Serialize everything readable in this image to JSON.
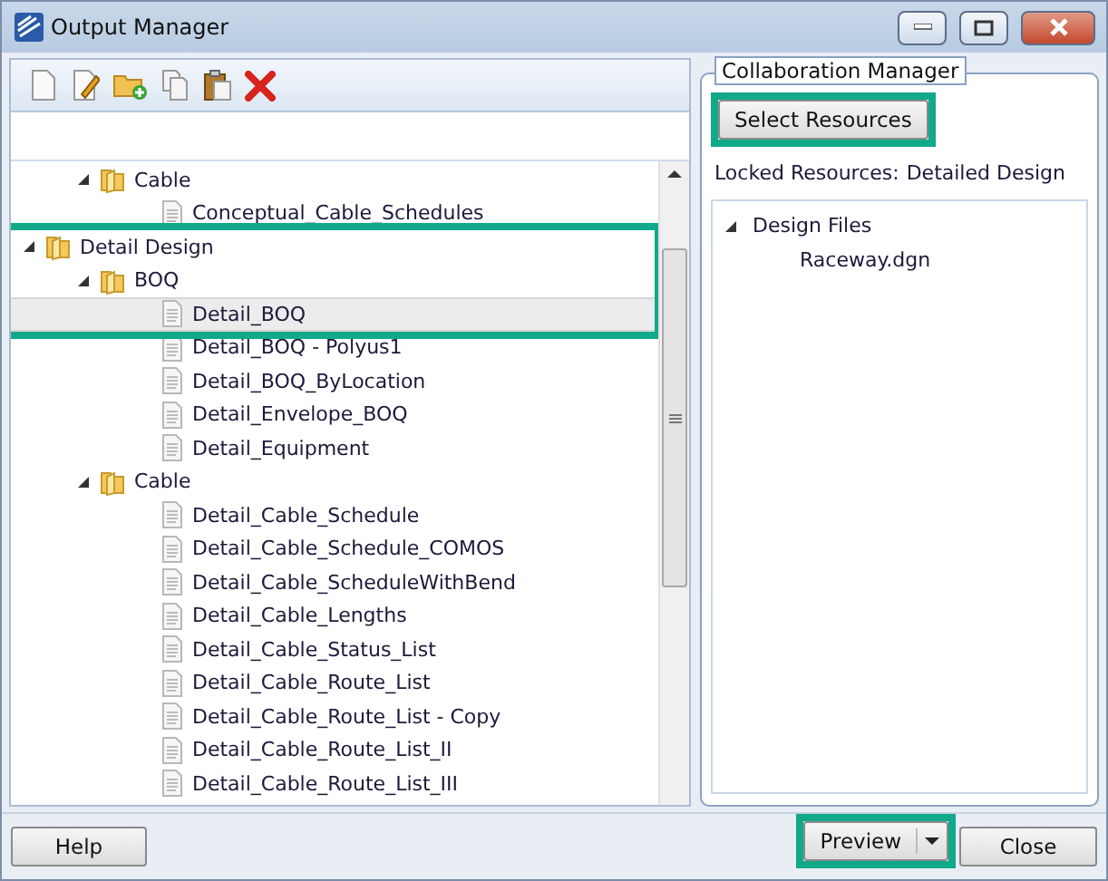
{
  "window": {
    "title": "Output Manager"
  },
  "toolbar": [
    {
      "kind": "new"
    },
    {
      "kind": "edit"
    },
    {
      "kind": "add-folder"
    },
    {
      "kind": "copy"
    },
    {
      "kind": "paste"
    },
    {
      "kind": "delete"
    }
  ],
  "tree": {
    "scrolled_branch": [
      {
        "label": "Cable",
        "kind": "folder",
        "expanded": true,
        "selected": false,
        "highlighted": false,
        "children": [
          {
            "label": "Conceptual_Cable_Schedules",
            "kind": "file",
            "selected": false,
            "highlighted": false
          }
        ]
      }
    ],
    "items": [
      {
        "label": "Detail Design",
        "kind": "folder",
        "expanded": true,
        "selected": false,
        "highlighted": true,
        "children": [
          {
            "label": "BOQ",
            "kind": "folder",
            "expanded": true,
            "selected": false,
            "highlighted": true,
            "children": [
              {
                "label": "Detail_BOQ",
                "kind": "file",
                "selected": true,
                "highlighted": true
              },
              {
                "label": "Detail_BOQ - Polyus1",
                "kind": "file",
                "selected": false,
                "highlighted": false
              },
              {
                "label": "Detail_BOQ_ByLocation",
                "kind": "file",
                "selected": false,
                "highlighted": false
              },
              {
                "label": "Detail_Envelope_BOQ",
                "kind": "file",
                "selected": false,
                "highlighted": false
              },
              {
                "label": "Detail_Equipment",
                "kind": "file",
                "selected": false,
                "highlighted": false
              }
            ]
          },
          {
            "label": "Cable",
            "kind": "folder",
            "expanded": true,
            "selected": false,
            "highlighted": false,
            "children": [
              {
                "label": "Detail_Cable_Schedule",
                "kind": "file",
                "selected": false,
                "highlighted": false
              },
              {
                "label": "Detail_Cable_Schedule_COMOS",
                "kind": "file",
                "selected": false,
                "highlighted": false
              },
              {
                "label": "Detail_Cable_ScheduleWithBend",
                "kind": "file",
                "selected": false,
                "highlighted": false
              },
              {
                "label": "Detail_Cable_Lengths",
                "kind": "file",
                "selected": false,
                "highlighted": false
              },
              {
                "label": "Detail_Cable_Status_List",
                "kind": "file",
                "selected": false,
                "highlighted": false
              },
              {
                "label": "Detail_Cable_Route_List",
                "kind": "file",
                "selected": false,
                "highlighted": false
              },
              {
                "label": "Detail_Cable_Route_List - Copy",
                "kind": "file",
                "selected": false,
                "highlighted": false
              },
              {
                "label": "Detail_Cable_Route_List_II",
                "kind": "file",
                "selected": false,
                "highlighted": false
              },
              {
                "label": "Detail_Cable_Route_List_III",
                "kind": "file",
                "selected": false,
                "highlighted": false
              }
            ]
          }
        ]
      }
    ]
  },
  "collaboration": {
    "title": "Collaboration Manager",
    "select_button": {
      "label": "Select Resources",
      "highlighted": true
    },
    "locked_label": "Locked Resources:",
    "locked_value": "Detailed Design",
    "files": [
      {
        "label": "Design Files",
        "expanded": true,
        "children": [
          {
            "label": "Raceway.dgn"
          }
        ]
      }
    ]
  },
  "buttons": {
    "help": "Help",
    "preview": {
      "label": "Preview",
      "highlighted": true
    },
    "close": "Close"
  }
}
